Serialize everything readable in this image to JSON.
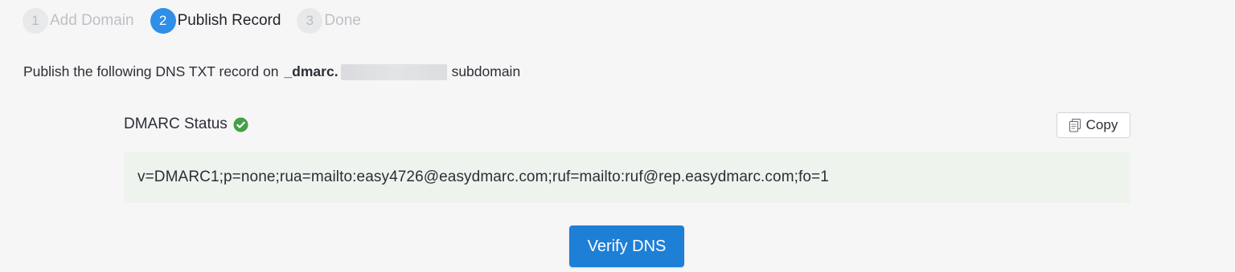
{
  "stepper": {
    "steps": [
      {
        "number": "1",
        "label": "Add Domain",
        "state": "inactive"
      },
      {
        "number": "2",
        "label": "Publish Record",
        "state": "active"
      },
      {
        "number": "3",
        "label": "Done",
        "state": "inactive"
      }
    ]
  },
  "instruction": {
    "prefix": "Publish the following DNS TXT record on",
    "host": "_dmarc.",
    "suffix": "subdomain"
  },
  "status": {
    "title": "DMARC Status",
    "icon": "check-circle-icon",
    "color": "#43a047"
  },
  "copy_button": {
    "label": "Copy",
    "icon": "copy-icon"
  },
  "record": {
    "value": "v=DMARC1;p=none;rua=mailto:easy4726@easydmarc.com;ruf=mailto:ruf@rep.easydmarc.com;fo=1"
  },
  "verify_button": {
    "label": "Verify DNS"
  },
  "colors": {
    "primary": "#1e7fd6",
    "active_step": "#2f8ee6",
    "success": "#43a047",
    "record_bg": "#eef3ee"
  }
}
